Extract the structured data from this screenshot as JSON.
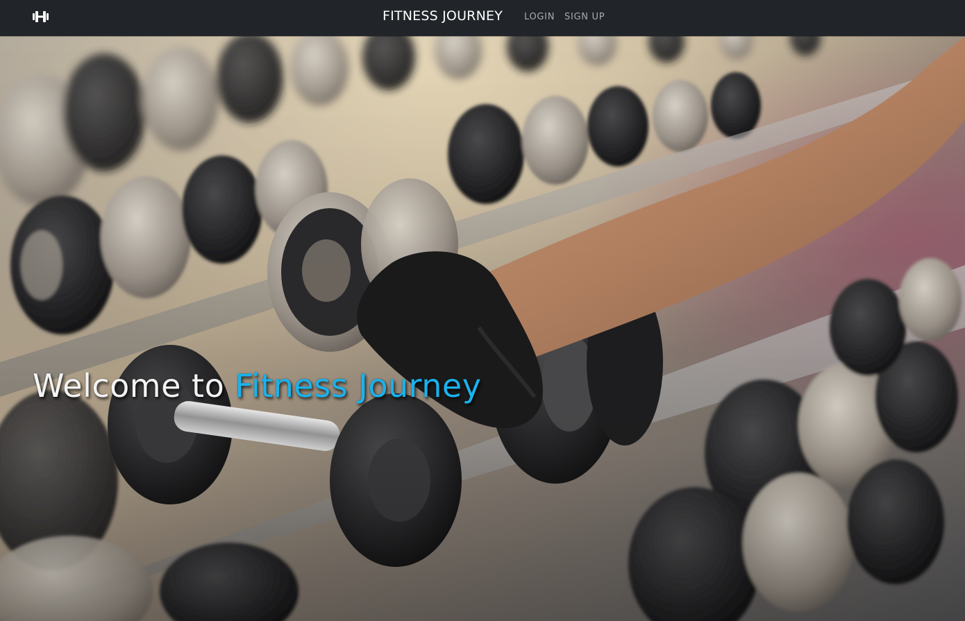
{
  "navbar": {
    "logo_icon": "dumbbell-icon",
    "brand": "FITNESS JOURNEY",
    "links": [
      {
        "label": "LOGIN"
      },
      {
        "label": "SIGN UP"
      }
    ]
  },
  "hero": {
    "headline_prefix": "Welcome to",
    "headline_accent": "Fitness Journey",
    "background_image": "gym-dumbbell-rack-photo",
    "accent_color": "#1ab2ec"
  }
}
